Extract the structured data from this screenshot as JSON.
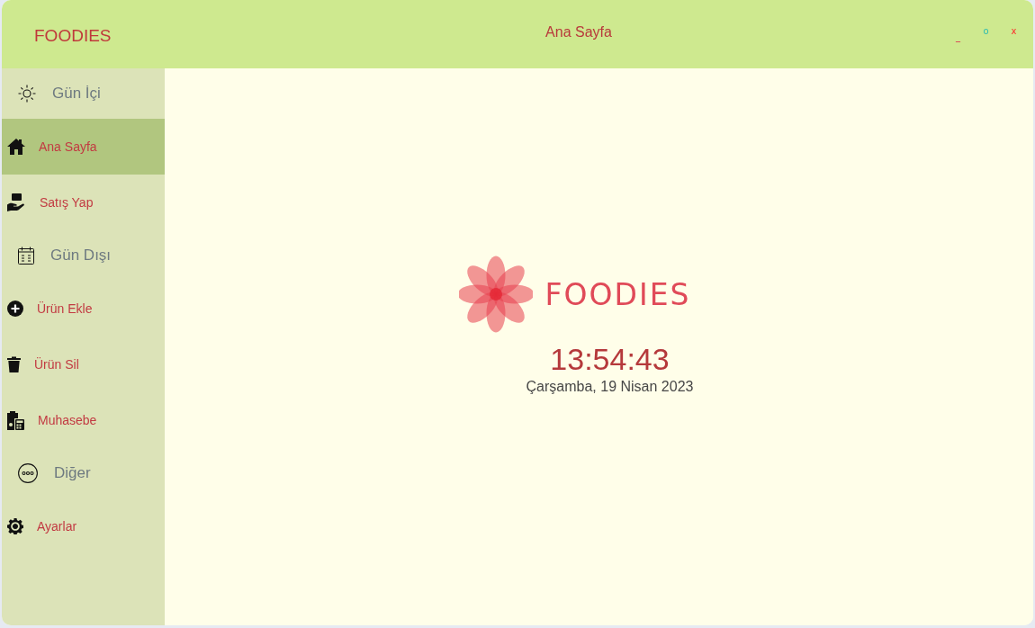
{
  "window": {
    "brand": "FOODIES",
    "title": "Ana Sayfa",
    "controls": [
      "_",
      "o",
      "x"
    ]
  },
  "sidebar": {
    "items": [
      {
        "kind": "group",
        "label": "Gün İçi",
        "selected": false
      },
      {
        "kind": "link",
        "label": "Ana Sayfa",
        "selected": true
      },
      {
        "kind": "link",
        "label": "Satış Yap",
        "selected": false
      },
      {
        "kind": "group",
        "label": "Gün Dışı",
        "selected": false
      },
      {
        "kind": "link",
        "label": "Ürün Ekle",
        "selected": false
      },
      {
        "kind": "link",
        "label": "Ürün Sil",
        "selected": false
      },
      {
        "kind": "link",
        "label": "Muhasebe",
        "selected": false
      },
      {
        "kind": "group",
        "label": "Diğer",
        "selected": false
      },
      {
        "kind": "link",
        "label": "Ayarlar",
        "selected": false
      }
    ]
  },
  "main": {
    "logo": {
      "text": "FOODIES"
    },
    "clock": {
      "time": "13:54:43",
      "date": "Çarşamba, 19 Nisan 2023"
    }
  }
}
